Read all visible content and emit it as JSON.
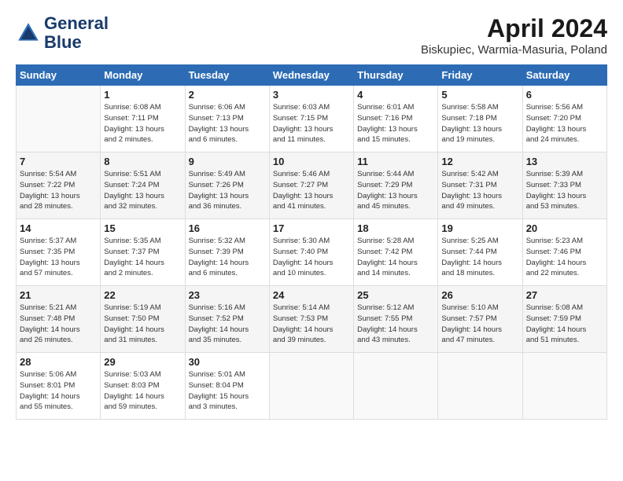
{
  "header": {
    "logo_line1": "General",
    "logo_line2": "Blue",
    "month_title": "April 2024",
    "location": "Biskupiec, Warmia-Masuria, Poland"
  },
  "weekdays": [
    "Sunday",
    "Monday",
    "Tuesday",
    "Wednesday",
    "Thursday",
    "Friday",
    "Saturday"
  ],
  "weeks": [
    [
      {
        "day": "",
        "info": ""
      },
      {
        "day": "1",
        "info": "Sunrise: 6:08 AM\nSunset: 7:11 PM\nDaylight: 13 hours\nand 2 minutes."
      },
      {
        "day": "2",
        "info": "Sunrise: 6:06 AM\nSunset: 7:13 PM\nDaylight: 13 hours\nand 6 minutes."
      },
      {
        "day": "3",
        "info": "Sunrise: 6:03 AM\nSunset: 7:15 PM\nDaylight: 13 hours\nand 11 minutes."
      },
      {
        "day": "4",
        "info": "Sunrise: 6:01 AM\nSunset: 7:16 PM\nDaylight: 13 hours\nand 15 minutes."
      },
      {
        "day": "5",
        "info": "Sunrise: 5:58 AM\nSunset: 7:18 PM\nDaylight: 13 hours\nand 19 minutes."
      },
      {
        "day": "6",
        "info": "Sunrise: 5:56 AM\nSunset: 7:20 PM\nDaylight: 13 hours\nand 24 minutes."
      }
    ],
    [
      {
        "day": "7",
        "info": "Sunrise: 5:54 AM\nSunset: 7:22 PM\nDaylight: 13 hours\nand 28 minutes."
      },
      {
        "day": "8",
        "info": "Sunrise: 5:51 AM\nSunset: 7:24 PM\nDaylight: 13 hours\nand 32 minutes."
      },
      {
        "day": "9",
        "info": "Sunrise: 5:49 AM\nSunset: 7:26 PM\nDaylight: 13 hours\nand 36 minutes."
      },
      {
        "day": "10",
        "info": "Sunrise: 5:46 AM\nSunset: 7:27 PM\nDaylight: 13 hours\nand 41 minutes."
      },
      {
        "day": "11",
        "info": "Sunrise: 5:44 AM\nSunset: 7:29 PM\nDaylight: 13 hours\nand 45 minutes."
      },
      {
        "day": "12",
        "info": "Sunrise: 5:42 AM\nSunset: 7:31 PM\nDaylight: 13 hours\nand 49 minutes."
      },
      {
        "day": "13",
        "info": "Sunrise: 5:39 AM\nSunset: 7:33 PM\nDaylight: 13 hours\nand 53 minutes."
      }
    ],
    [
      {
        "day": "14",
        "info": "Sunrise: 5:37 AM\nSunset: 7:35 PM\nDaylight: 13 hours\nand 57 minutes."
      },
      {
        "day": "15",
        "info": "Sunrise: 5:35 AM\nSunset: 7:37 PM\nDaylight: 14 hours\nand 2 minutes."
      },
      {
        "day": "16",
        "info": "Sunrise: 5:32 AM\nSunset: 7:39 PM\nDaylight: 14 hours\nand 6 minutes."
      },
      {
        "day": "17",
        "info": "Sunrise: 5:30 AM\nSunset: 7:40 PM\nDaylight: 14 hours\nand 10 minutes."
      },
      {
        "day": "18",
        "info": "Sunrise: 5:28 AM\nSunset: 7:42 PM\nDaylight: 14 hours\nand 14 minutes."
      },
      {
        "day": "19",
        "info": "Sunrise: 5:25 AM\nSunset: 7:44 PM\nDaylight: 14 hours\nand 18 minutes."
      },
      {
        "day": "20",
        "info": "Sunrise: 5:23 AM\nSunset: 7:46 PM\nDaylight: 14 hours\nand 22 minutes."
      }
    ],
    [
      {
        "day": "21",
        "info": "Sunrise: 5:21 AM\nSunset: 7:48 PM\nDaylight: 14 hours\nand 26 minutes."
      },
      {
        "day": "22",
        "info": "Sunrise: 5:19 AM\nSunset: 7:50 PM\nDaylight: 14 hours\nand 31 minutes."
      },
      {
        "day": "23",
        "info": "Sunrise: 5:16 AM\nSunset: 7:52 PM\nDaylight: 14 hours\nand 35 minutes."
      },
      {
        "day": "24",
        "info": "Sunrise: 5:14 AM\nSunset: 7:53 PM\nDaylight: 14 hours\nand 39 minutes."
      },
      {
        "day": "25",
        "info": "Sunrise: 5:12 AM\nSunset: 7:55 PM\nDaylight: 14 hours\nand 43 minutes."
      },
      {
        "day": "26",
        "info": "Sunrise: 5:10 AM\nSunset: 7:57 PM\nDaylight: 14 hours\nand 47 minutes."
      },
      {
        "day": "27",
        "info": "Sunrise: 5:08 AM\nSunset: 7:59 PM\nDaylight: 14 hours\nand 51 minutes."
      }
    ],
    [
      {
        "day": "28",
        "info": "Sunrise: 5:06 AM\nSunset: 8:01 PM\nDaylight: 14 hours\nand 55 minutes."
      },
      {
        "day": "29",
        "info": "Sunrise: 5:03 AM\nSunset: 8:03 PM\nDaylight: 14 hours\nand 59 minutes."
      },
      {
        "day": "30",
        "info": "Sunrise: 5:01 AM\nSunset: 8:04 PM\nDaylight: 15 hours\nand 3 minutes."
      },
      {
        "day": "",
        "info": ""
      },
      {
        "day": "",
        "info": ""
      },
      {
        "day": "",
        "info": ""
      },
      {
        "day": "",
        "info": ""
      }
    ]
  ]
}
